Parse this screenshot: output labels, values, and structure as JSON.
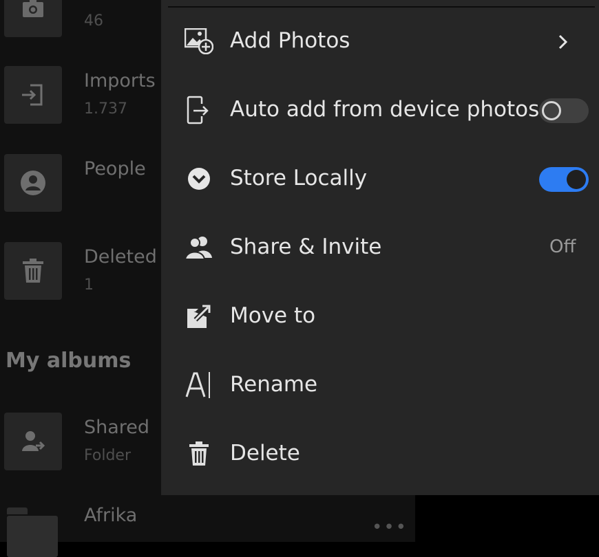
{
  "background_list": {
    "items": [
      {
        "title": "",
        "count": "46",
        "icon": "camera-icon"
      },
      {
        "title": "Imports",
        "count": "1.737",
        "icon": "import-icon"
      },
      {
        "title": "People",
        "count": "",
        "icon": "person-icon"
      },
      {
        "title": "Deleted",
        "count": "1",
        "icon": "trash-icon"
      }
    ],
    "section_title": "My albums",
    "albums": [
      {
        "title": "Shared",
        "subtitle": "Folder",
        "icon": "shared-folder-icon"
      },
      {
        "title": "Afrika",
        "subtitle": "",
        "icon": "folder-icon"
      }
    ],
    "more": "•••"
  },
  "menu": {
    "items": [
      {
        "label": "Add Photos",
        "icon": "add-photo-icon",
        "accessory": "chevron"
      },
      {
        "label": "Auto add from device photos",
        "icon": "device-share-icon",
        "accessory": "toggle",
        "toggle_on": false
      },
      {
        "label": "Store Locally",
        "icon": "chevron-circle-icon",
        "accessory": "toggle",
        "toggle_on": true
      },
      {
        "label": "Share & Invite",
        "icon": "people-icon",
        "accessory": "status",
        "status": "Off"
      },
      {
        "label": "Move to",
        "icon": "move-icon",
        "accessory": "none"
      },
      {
        "label": "Rename",
        "icon": "rename-icon",
        "accessory": "none"
      },
      {
        "label": "Delete",
        "icon": "trash-icon",
        "accessory": "none"
      }
    ]
  },
  "colors": {
    "menu_bg": "#262626",
    "toggle_on": "#2d7cf2",
    "text_primary": "#e6e6e6"
  }
}
